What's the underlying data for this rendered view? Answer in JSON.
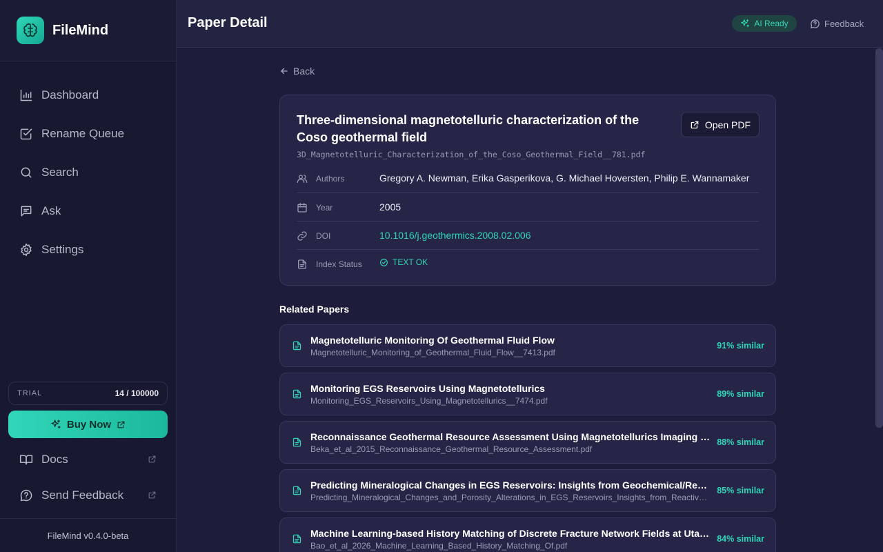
{
  "app": {
    "name": "FileMind",
    "version": "FileMind v0.4.0-beta"
  },
  "sidebar": {
    "nav": [
      {
        "label": "Dashboard",
        "icon": "bar-chart-icon"
      },
      {
        "label": "Rename Queue",
        "icon": "checkbox-icon"
      },
      {
        "label": "Search",
        "icon": "search-icon"
      },
      {
        "label": "Ask",
        "icon": "message-icon"
      },
      {
        "label": "Settings",
        "icon": "gear-icon"
      }
    ],
    "trial": {
      "label": "TRIAL",
      "count": "14 / 100000"
    },
    "buy_label": "Buy Now",
    "docs_label": "Docs",
    "send_feedback_label": "Send Feedback"
  },
  "header": {
    "title": "Paper Detail",
    "ai_status": "AI Ready",
    "feedback_label": "Feedback"
  },
  "main": {
    "back_label": "Back",
    "paper": {
      "title": "Three-dimensional magnetotelluric characterization of the Coso geothermal field",
      "filename": "3D_Magnetotelluric_Characterization_of_the_Coso_Geothermal_Field__781.pdf",
      "open_pdf_label": "Open PDF",
      "meta": {
        "authors_label": "Authors",
        "authors": "Gregory A. Newman, Erika Gasperikova, G. Michael Hoversten, Philip E. Wannamaker",
        "year_label": "Year",
        "year": "2005",
        "doi_label": "DOI",
        "doi": "10.1016/j.geothermics.2008.02.006",
        "index_label": "Index Status",
        "index_status": "TEXT OK"
      }
    },
    "related_title": "Related Papers",
    "related": [
      {
        "title": "Magnetotelluric Monitoring Of Geothermal Fluid Flow",
        "file": "Magnetotelluric_Monitoring_of_Geothermal_Fluid_Flow__7413.pdf",
        "similarity": "91% similar"
      },
      {
        "title": "Monitoring EGS Reservoirs Using Magnetotellurics",
        "file": "Monitoring_EGS_Reservoirs_Using_Magnetotellurics__7474.pdf",
        "similarity": "89% similar"
      },
      {
        "title": "Reconnaissance Geothermal Resource Assessment Using Magnetotellurics Imaging on the Island of Montserrat",
        "file": "Beka_et_al_2015_Reconnaissance_Geothermal_Resource_Assessment.pdf",
        "similarity": "88% similar"
      },
      {
        "title": "Predicting Mineralogical Changes in EGS Reservoirs: Insights from Geochemical/Reactive Transport Modeling",
        "file": "Predicting_Mineralogical_Changes_and_Porosity_Alterations_in_EGS_Reservoirs_Insights_from_Reactive_Transport.pdf",
        "similarity": "85% similar"
      },
      {
        "title": "Machine Learning-based History Matching of Discrete Fracture Network Fields at Utah FORGE",
        "file": "Bao_et_al_2026_Machine_Learning_Based_History_Matching_Of.pdf",
        "similarity": "84% similar"
      }
    ]
  },
  "colors": {
    "accent": "#2fd6b8",
    "background": "#1d1c3a",
    "sidebar": "#181830",
    "card": "#262547"
  }
}
